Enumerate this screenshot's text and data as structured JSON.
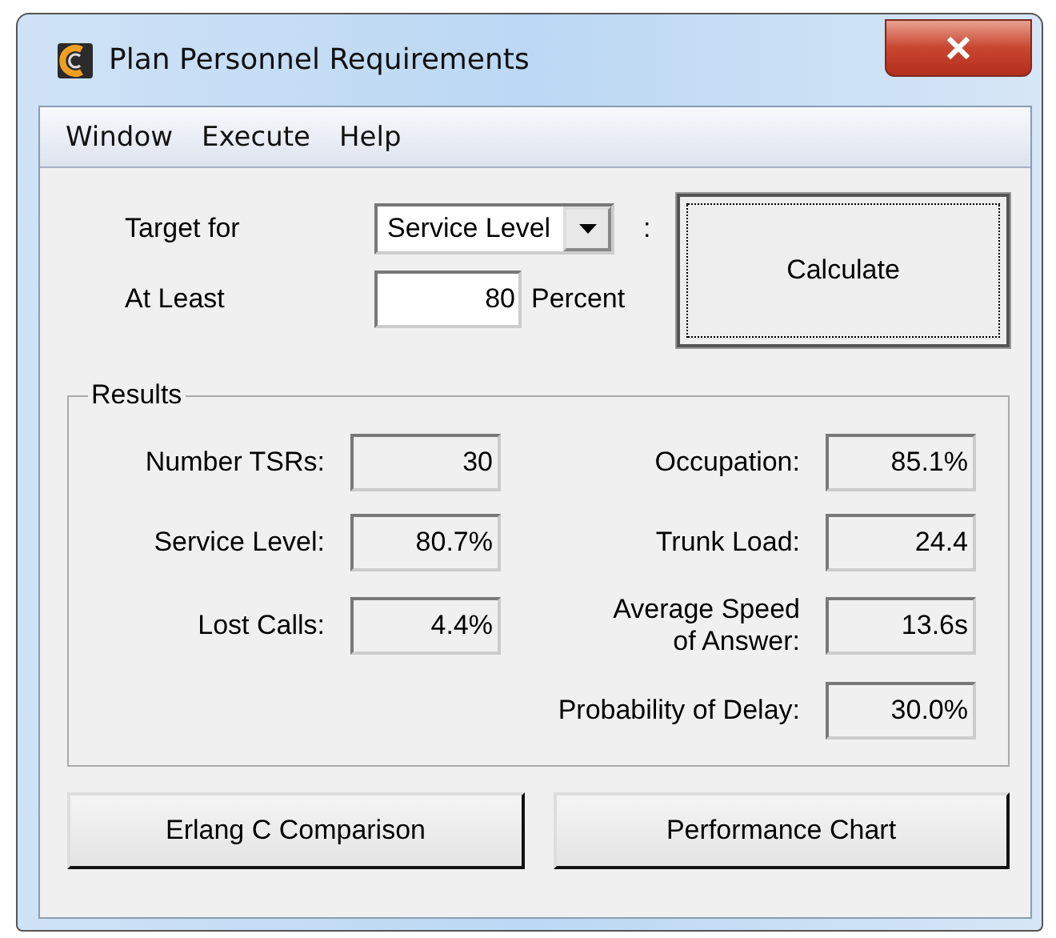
{
  "window": {
    "title": "Plan Personnel Requirements"
  },
  "menu": [
    "Window",
    "Execute",
    "Help"
  ],
  "target": {
    "label": "Target for",
    "value": "Service Level",
    "suffix": ":"
  },
  "minimum": {
    "label": "At Least",
    "value": "80",
    "unit": "Percent"
  },
  "calculate_button": {
    "label": "Calculate",
    "focused": true
  },
  "results": {
    "title": "Results",
    "left": [
      {
        "label": "Number TSRs:",
        "value": "30"
      },
      {
        "label": "Service Level:",
        "value": "80.7%"
      },
      {
        "label": "Lost Calls:",
        "value": "4.4%"
      }
    ],
    "right": [
      {
        "label": "Occupation:",
        "value": "85.1%"
      },
      {
        "label": "Trunk Load:",
        "value": "24.4"
      },
      {
        "label": "Average Speed\nof Answer:",
        "value": "13.6s"
      },
      {
        "label": "Probability of Delay:",
        "value": "30.0%"
      }
    ]
  },
  "buttons": [
    "Erlang C Comparison",
    "Performance Chart"
  ]
}
